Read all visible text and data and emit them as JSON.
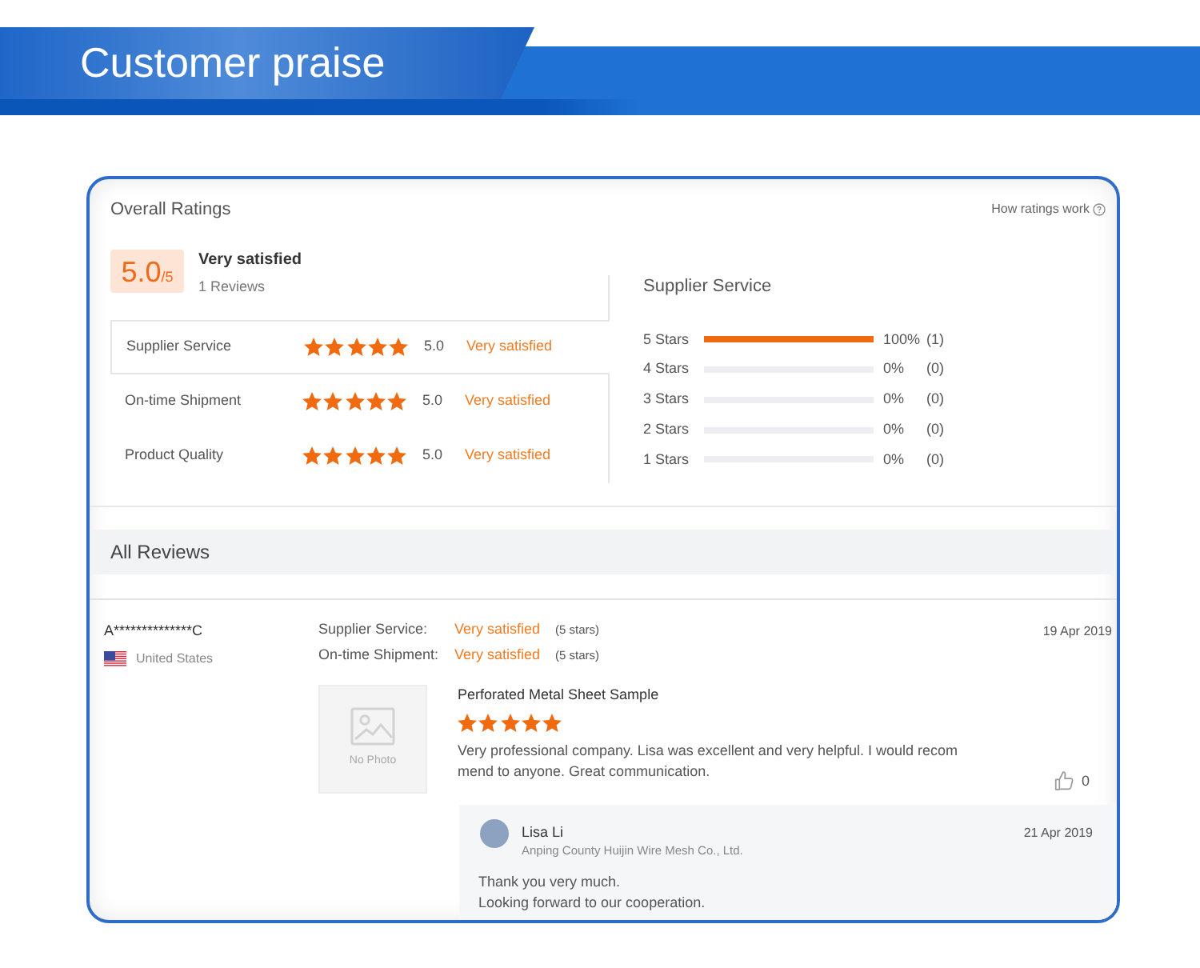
{
  "banner": {
    "title": "Customer praise"
  },
  "overall_ratings": {
    "title": "Overall Ratings",
    "help_link": "How ratings work",
    "score": "5.0",
    "score_max": "/5",
    "verdict": "Very satisfied",
    "review_count": "1 Reviews",
    "categories": [
      {
        "label": "Supplier Service",
        "stars": 5,
        "score": "5.0",
        "verdict": "Very satisfied",
        "selected": true
      },
      {
        "label": "On-time Shipment",
        "stars": 5,
        "score": "5.0",
        "verdict": "Very satisfied",
        "selected": false
      },
      {
        "label": "Product Quality",
        "stars": 5,
        "score": "5.0",
        "verdict": "Very satisfied",
        "selected": false
      }
    ]
  },
  "breakdown": {
    "title": "Supplier Service",
    "rows": [
      {
        "label": "5 Stars",
        "level": 1,
        "percent": "100%",
        "count": "(1)"
      },
      {
        "label": "4 Stars",
        "level": 0,
        "percent": "0%",
        "count": "(0)"
      },
      {
        "label": "3 Stars",
        "level": 0,
        "percent": "0%",
        "count": "(0)"
      },
      {
        "label": "2 Stars",
        "level": 0,
        "percent": "0%",
        "count": "(0)"
      },
      {
        "label": "1 Stars",
        "level": 0,
        "percent": "0%",
        "count": "(0)"
      }
    ]
  },
  "all_reviews": {
    "title": "All Reviews",
    "reviews": [
      {
        "reviewer": "A**************C",
        "country": "United States",
        "date": "19 Apr 2019",
        "ratings": [
          {
            "label": "Supplier Service:",
            "verdict": "Very satisfied",
            "stars_text": "(5 stars)"
          },
          {
            "label": "On-time Shipment:",
            "verdict": "Very satisfied",
            "stars_text": "(5 stars)"
          }
        ],
        "photo_placeholder": "No Photo",
        "product": "Perforated Metal Sheet Sample",
        "stars": 5,
        "text": "Very professional company. Lisa was excellent and very helpful. I would recommend to anyone. Great communication.",
        "likes": "0",
        "reply": {
          "name": "Lisa Li",
          "company": "Anping County Huijin Wire Mesh Co., Ltd.",
          "date": "21 Apr 2019",
          "text": "Thank you very much.\nLooking forward to our cooperation."
        }
      }
    ]
  }
}
